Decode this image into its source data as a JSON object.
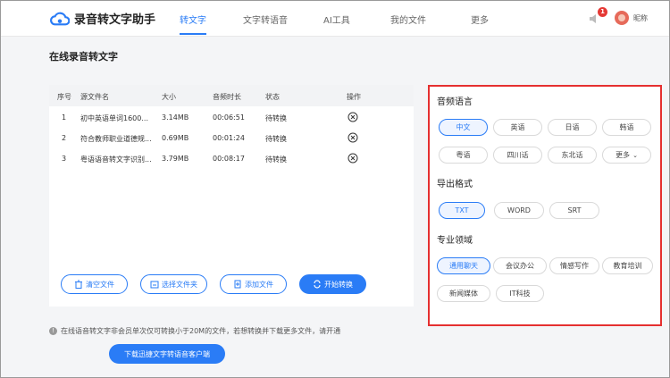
{
  "header": {
    "app_title": "录音转文字助手",
    "nav": [
      {
        "label": "转文字",
        "active": true
      },
      {
        "label": "文字转语音",
        "active": false
      },
      {
        "label": "AI工具",
        "active": false
      },
      {
        "label": "我的文件",
        "active": false
      },
      {
        "label": "更多",
        "active": false
      }
    ],
    "notification_count": "1",
    "nickname": "昵称"
  },
  "page_title": "在线录音转文字",
  "table": {
    "columns": [
      "序号",
      "源文件名",
      "大小",
      "音频时长",
      "状态",
      "操作"
    ],
    "rows": [
      {
        "index": "1",
        "name": "初中英语单词1600...",
        "size": "3.14MB",
        "duration": "00:06:51",
        "status": "待转换"
      },
      {
        "index": "2",
        "name": "符合教师职业道德规...",
        "size": "0.69MB",
        "duration": "00:01:24",
        "status": "待转换"
      },
      {
        "index": "3",
        "name": "粤语语音转文字识别...",
        "size": "3.79MB",
        "duration": "00:08:17",
        "status": "待转换"
      }
    ]
  },
  "actions": {
    "clear": "清空文件",
    "select_folder": "选择文件夹",
    "add_file": "添加文件",
    "start": "开始转换"
  },
  "notice": "在线语音转文字非会员单次仅可转换小于20M的文件，若想转换并下载更多文件，请开通",
  "download_button": "下载迅捷文字转语音客户端",
  "settings": {
    "language_title": "音频语言",
    "languages": [
      "中文",
      "英语",
      "日语",
      "韩语",
      "粤语",
      "四川话",
      "东北话",
      "更多"
    ],
    "selected_language": "中文",
    "format_title": "导出格式",
    "formats": [
      "TXT",
      "WORD",
      "SRT"
    ],
    "selected_format": "TXT",
    "domain_title": "专业领域",
    "domains": [
      "通用聊天",
      "会议办公",
      "情感写作",
      "教育培训",
      "新闻媒体",
      "IT科技"
    ],
    "selected_domain": "通用聊天"
  },
  "colors": {
    "accent": "#2a7cf6",
    "highlight_border": "#e53030",
    "badge": "#e53935"
  }
}
